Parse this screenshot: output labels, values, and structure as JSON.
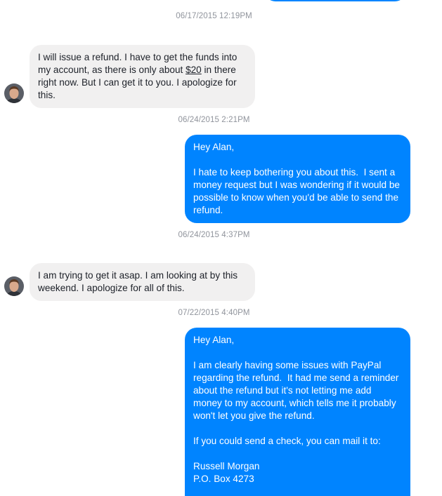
{
  "conversation": {
    "timestamps": [
      "06/17/2015 12:19PM",
      "06/24/2015 2:21PM",
      "06/24/2015 4:37PM",
      "07/22/2015 4:40PM"
    ],
    "messages": [
      {
        "from": "contact",
        "pre": "I will issue a refund. I have to get the funds into my account, as there is only about ",
        "link": "$20",
        "post": " in there right now. But I can get it to you. I apologize for this."
      },
      {
        "from": "me",
        "text": "Hey Alan,\n\nI hate to keep bothering you about this.  I sent a money request but I was wondering if it would be possible to know when you'd be able to send the refund."
      },
      {
        "from": "contact",
        "text": "I am trying to get it asap. I am looking at by this weekend. I apologize for all of this."
      },
      {
        "from": "me",
        "text": "Hey Alan,\n\nI am clearly having some issues with PayPal regarding the refund.  It had me send a reminder about the refund but it's not letting me add money to my account, which tells me it probably won't let you give the refund.\n\nIf you could send a check, you can mail it to:\n\nRussell Morgan\nP.O. Box 4273"
      }
    ]
  },
  "colors": {
    "outgoing_bubble": "#0084ff",
    "incoming_bubble": "#f1f0f0",
    "timestamp": "#90949c"
  },
  "icons": {
    "contact_avatar": "avatar-icon"
  }
}
